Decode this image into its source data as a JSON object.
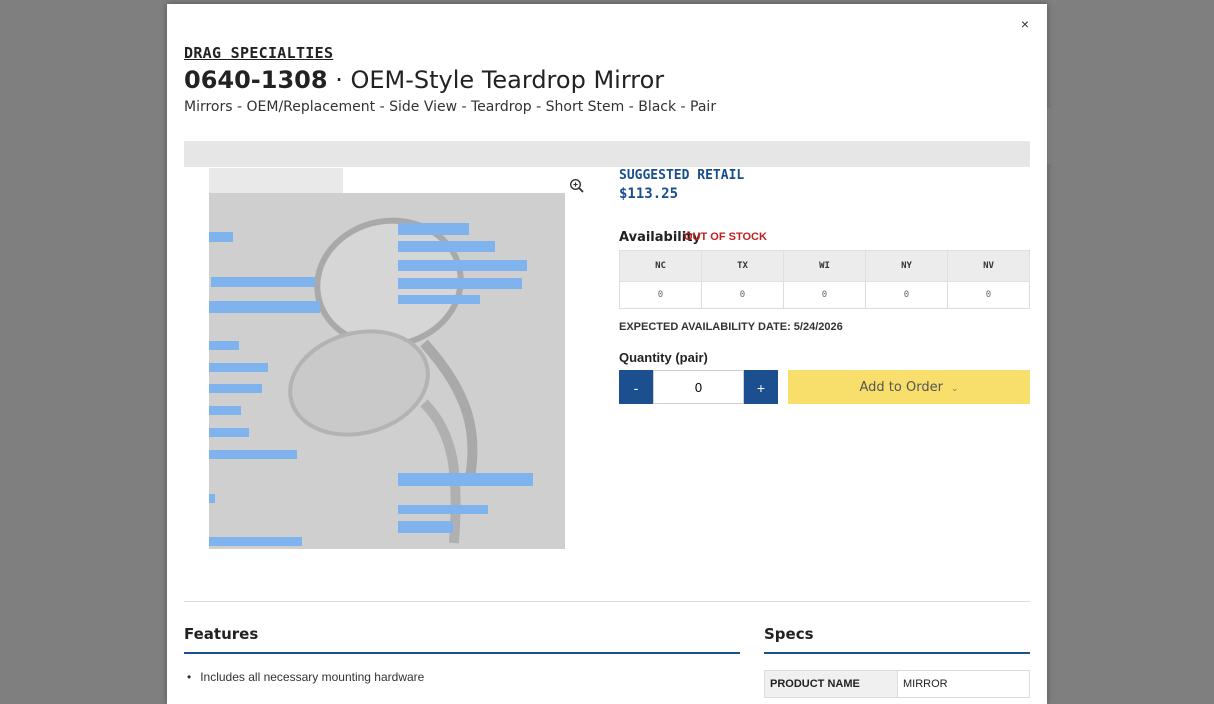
{
  "modal": {
    "close_label": "×",
    "brand": "DRAG SPECIALTIES",
    "part_number": "0640-1308",
    "separator": "·",
    "product_title": "OEM-Style Teardrop Mirror",
    "breadcrumbs": "Mirrors - OEM/Replacement - Side View - Teardrop - Short Stem - Black - Pair"
  },
  "image": {
    "zoom_icon": "zoom-in-icon"
  },
  "pricing": {
    "label": "SUGGESTED RETAIL",
    "price": "$113.25"
  },
  "availability": {
    "label": "Availability",
    "status": "OUT OF STOCK",
    "warehouses": [
      {
        "code": "NC",
        "qty": "0"
      },
      {
        "code": "TX",
        "qty": "0"
      },
      {
        "code": "WI",
        "qty": "0"
      },
      {
        "code": "NY",
        "qty": "0"
      },
      {
        "code": "NV",
        "qty": "0"
      }
    ],
    "expected_date": "EXPECTED AVAILABILITY DATE: 5/24/2026"
  },
  "quantity": {
    "label": "Quantity (pair)",
    "minus_label": "-",
    "plus_label": "+",
    "value": "0"
  },
  "order_button": {
    "label": "Add to Order",
    "chevron": "⌄"
  },
  "features": {
    "title": "Features",
    "items": [
      "Includes all necessary mounting hardware"
    ]
  },
  "specs": {
    "title": "Specs",
    "rows": [
      {
        "key": "PRODUCT NAME",
        "value": "MIRROR"
      }
    ]
  },
  "colors": {
    "accent": "#1b4f8f",
    "order_button": "#f8df6b",
    "out_of_stock": "#c0211e"
  }
}
